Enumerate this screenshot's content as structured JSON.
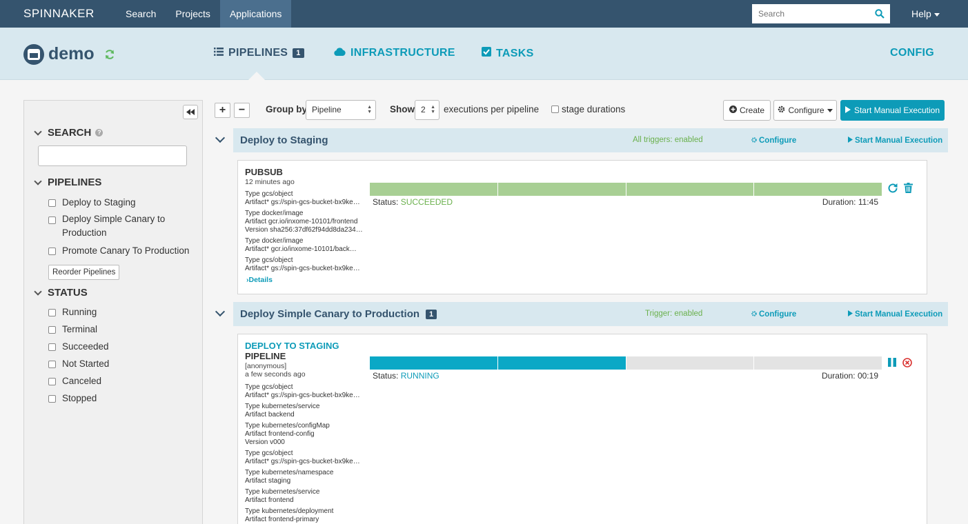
{
  "nav": {
    "brand": "SPINNAKER",
    "links": [
      "Search",
      "Projects",
      "Applications"
    ],
    "search_placeholder": "Search",
    "help": "Help"
  },
  "app": {
    "name": "demo",
    "tabs": {
      "pipelines": "PIPELINES",
      "pipelines_count": "1",
      "infrastructure": "INFRASTRUCTURE",
      "tasks": "TASKS",
      "config": "CONFIG"
    }
  },
  "sidebar": {
    "search_heading": "SEARCH",
    "pipelines_heading": "PIPELINES",
    "pipelines": [
      "Deploy to Staging",
      "Deploy Simple Canary to Production",
      "Promote Canary To Production"
    ],
    "reorder_label": "Reorder Pipelines",
    "status_heading": "STATUS",
    "statuses": [
      "Running",
      "Terminal",
      "Succeeded",
      "Not Started",
      "Canceled",
      "Stopped"
    ]
  },
  "toolbar": {
    "group_by_label": "Group by",
    "group_by_value": "Pipeline",
    "show_label": "Show",
    "show_value": "2",
    "executions_text": "executions per pipeline",
    "stage_durations": "stage durations",
    "create": "Create",
    "configure": "Configure",
    "start_manual": "Start Manual Execution"
  },
  "groups": [
    {
      "title": "Deploy to Staging",
      "trigger_status": "All triggers: enabled",
      "configure": "Configure",
      "start": "Start Manual Execution",
      "execution": {
        "trigger": "PUBSUB",
        "when": "12 minutes ago",
        "artifacts": [
          "Type  gcs/object",
          "Artifact*  gs://spin-gcs-bucket-bx9ke…",
          "Type  docker/image",
          "Artifact  gcr.io/inxome-10101/frontend",
          "Version  sha256:37df62f94dd8da234…",
          "Type  docker/image",
          "Artifact*  gcr.io/inxome-10101/back…",
          "Type  gcs/object",
          "Artifact*  gs://spin-gcs-bucket-bx9ke…"
        ],
        "details": "Details",
        "status_label": "Status:",
        "status": "SUCCEEDED",
        "duration": "Duration: 11:45"
      }
    },
    {
      "title": "Deploy Simple Canary to Production",
      "count": "1",
      "trigger_status": "Trigger: enabled",
      "configure": "Configure",
      "start": "Start Manual Execution",
      "execution": {
        "trigger_link": "DEPLOY TO STAGING",
        "trigger": "PIPELINE",
        "user": "[anonymous]",
        "when": "a few seconds ago",
        "artifacts": [
          "Type  gcs/object",
          "Artifact*  gs://spin-gcs-bucket-bx9ke…",
          "Type  kubernetes/service",
          "Artifact  backend",
          "Type  kubernetes/configMap",
          "Artifact  frontend-config",
          "Version  v000",
          "Type  gcs/object",
          "Artifact*  gs://spin-gcs-bucket-bx9ke…",
          "Type  kubernetes/namespace",
          "Artifact  staging",
          "Type  kubernetes/service",
          "Artifact  frontend",
          "Type  kubernetes/deployment",
          "Artifact  frontend-primary"
        ],
        "status_label": "Status:",
        "status": "RUNNING",
        "duration": "Duration: 00:19"
      }
    }
  ],
  "colors": {
    "nav_bg": "#35546e",
    "accent": "#0d9bb8",
    "succeeded": "#a8cf94",
    "running": "#0aa8c6",
    "danger": "#d9312f"
  }
}
